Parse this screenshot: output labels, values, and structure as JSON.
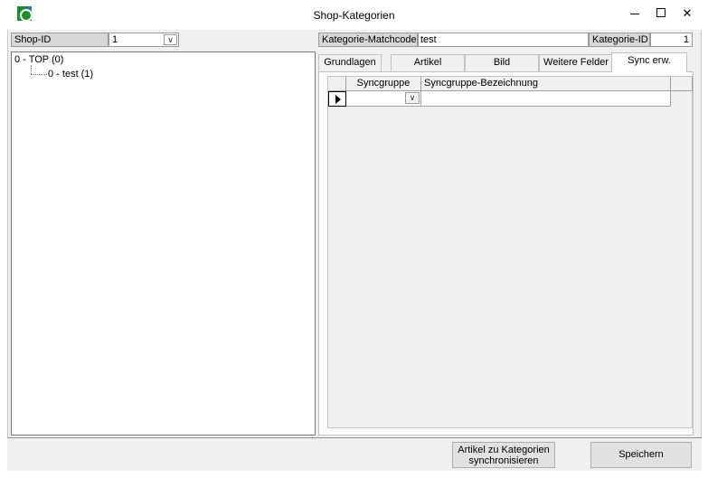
{
  "window": {
    "title": "Shop-Kategorien",
    "minimize": "–",
    "close": "✕"
  },
  "shop": {
    "id_label": "Shop-ID",
    "id_value": "1"
  },
  "tree": {
    "root": "0 - TOP (0)",
    "child": "0 - test (1)"
  },
  "category": {
    "matchcode_label": "Kategorie-Matchcode",
    "matchcode_value": "test",
    "id_label": "Kategorie-ID",
    "id_value": "1"
  },
  "tabs": [
    "Grundlagen",
    "Artikel",
    "Bild",
    "Weitere Felder",
    "Sync erw."
  ],
  "active_tab": "Sync erw.",
  "grid": {
    "columns": [
      "Syncgruppe",
      "Syncgruppe-Bezeichnung"
    ],
    "rows": [
      {
        "syncgruppe": "",
        "bezeichnung": ""
      }
    ]
  },
  "buttons": {
    "sync_line1": "Artikel zu Kategorien",
    "sync_line2": "synchronisieren",
    "save": "Speichern"
  },
  "icons": {
    "app": "app-icon",
    "dropdown": "chevron-down-icon",
    "row_pointer": "row-pointer-icon"
  }
}
